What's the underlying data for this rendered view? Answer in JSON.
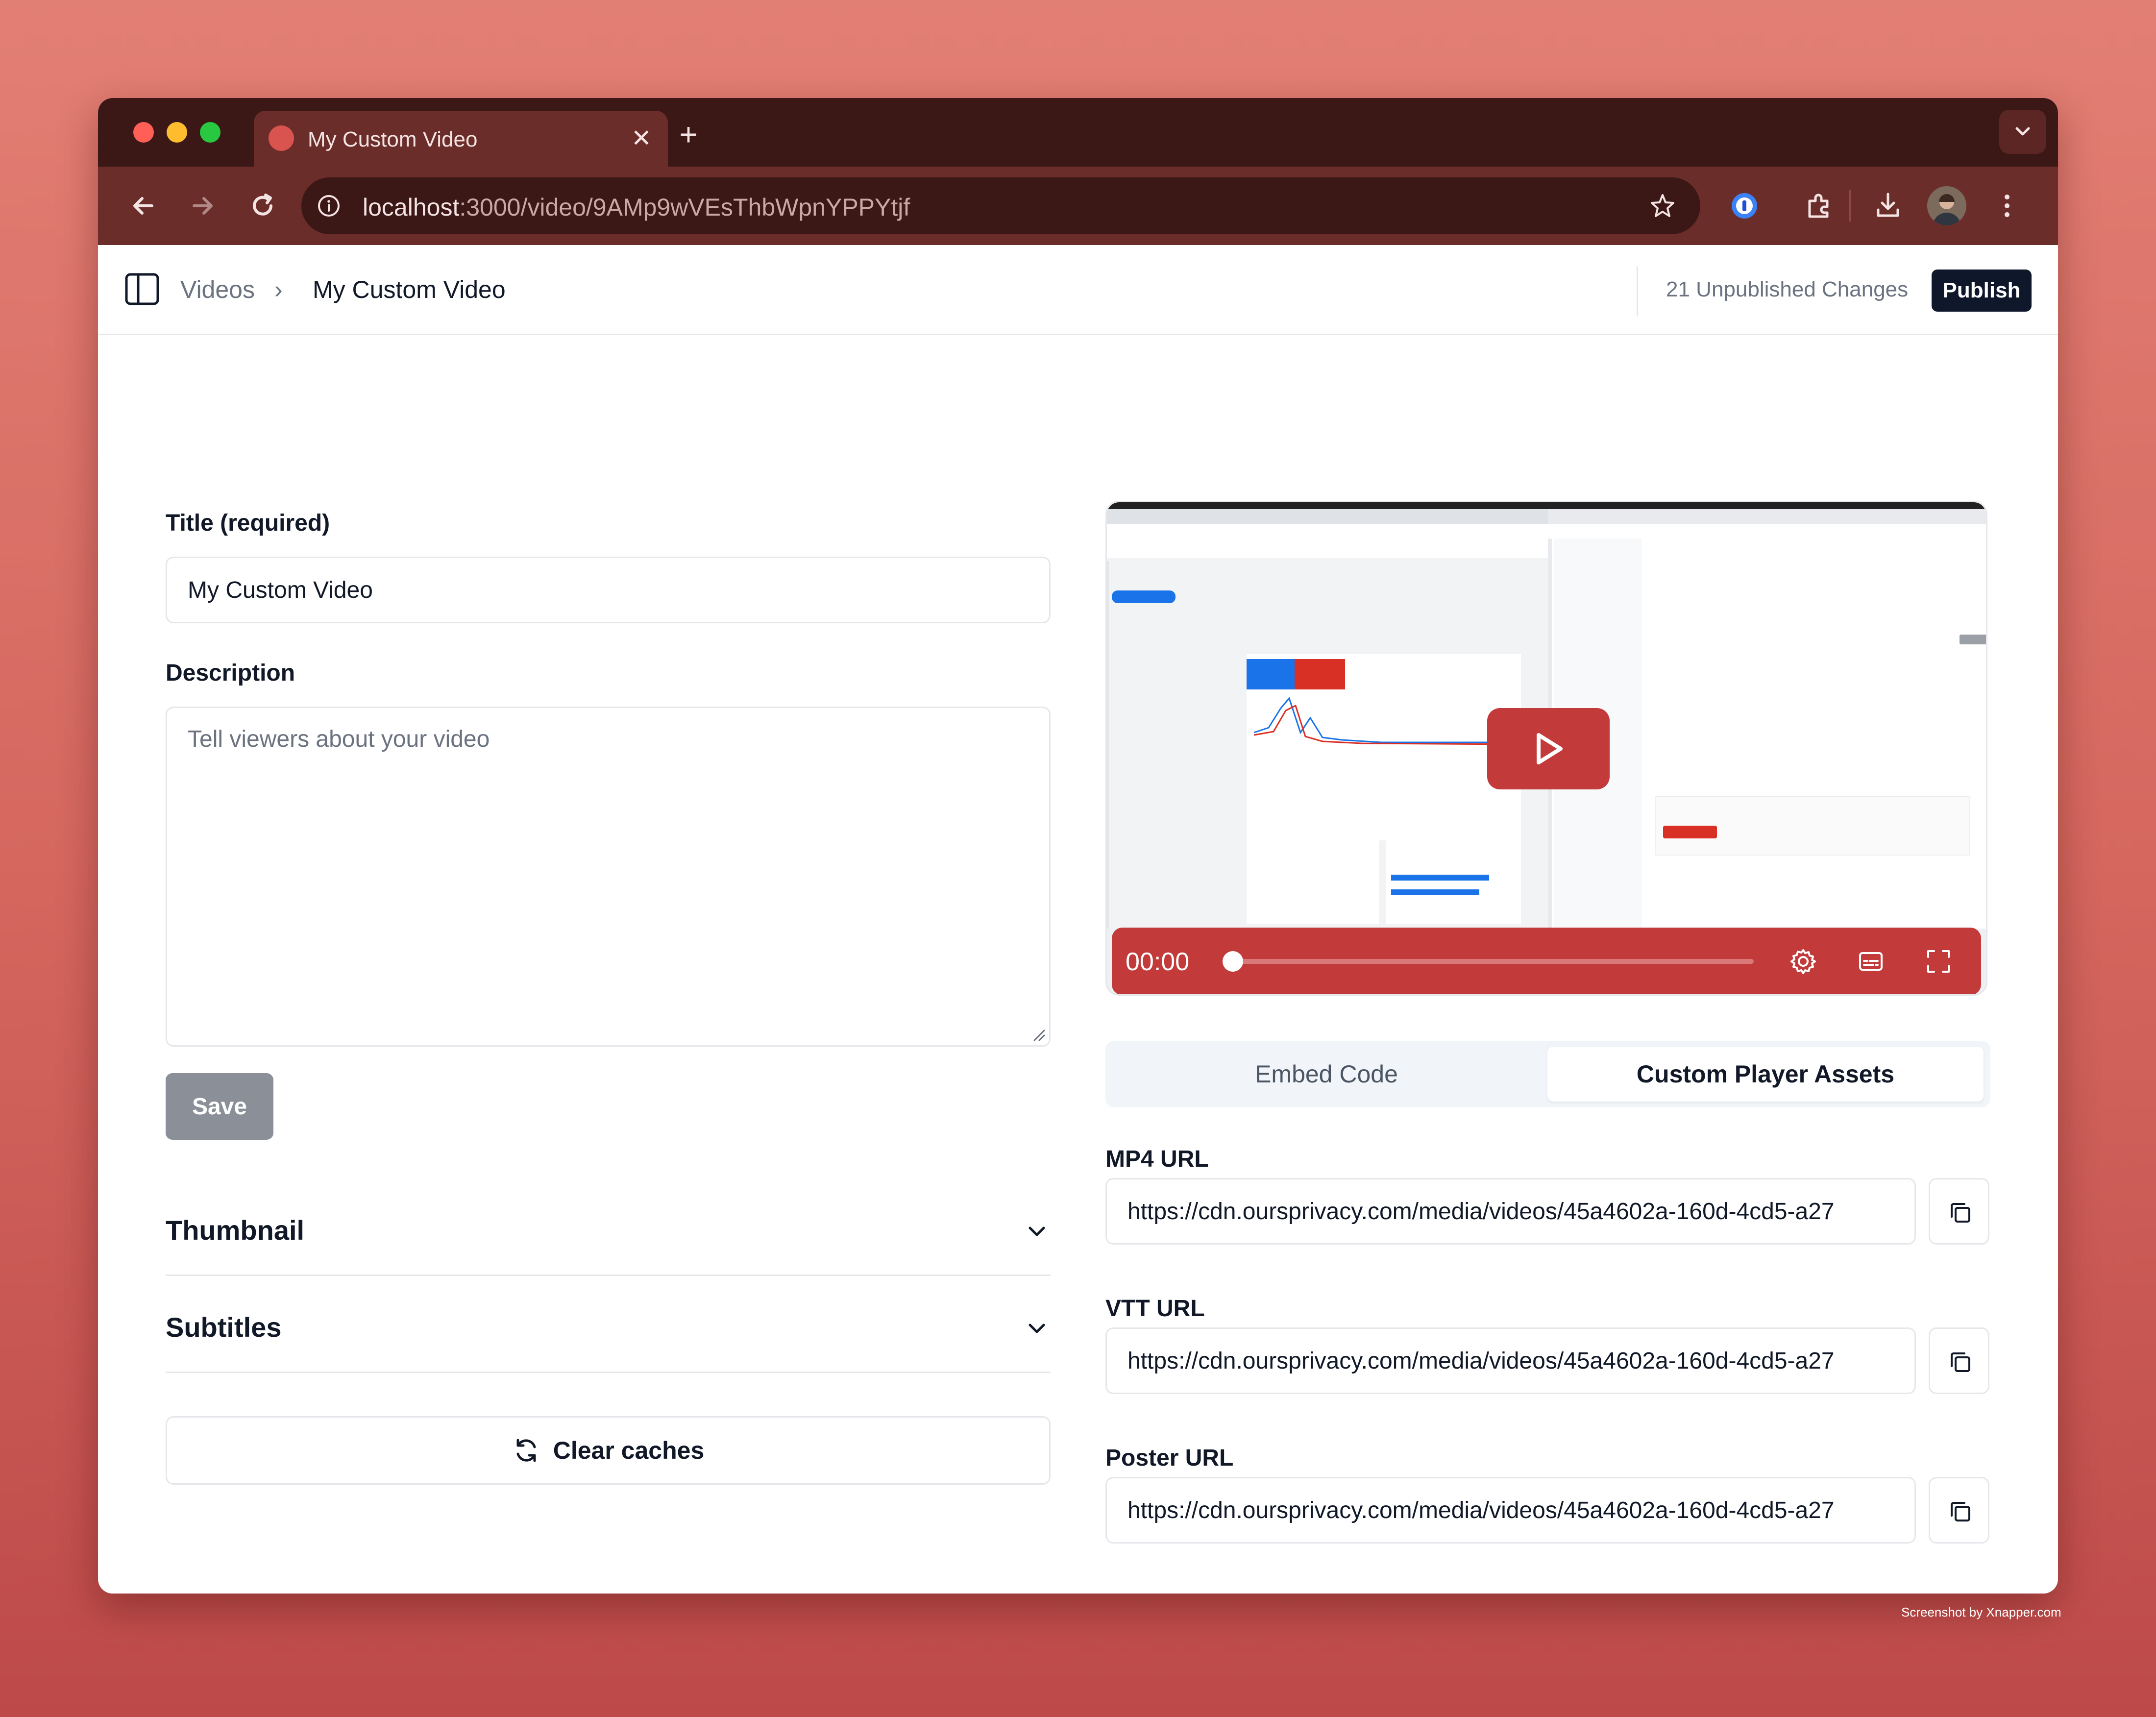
{
  "browser": {
    "tab_title": "My Custom Video",
    "new_tab_label": "+",
    "close_tab_label": "✕",
    "url_host": "localhost",
    "url_path": ":3000/video/9AMp9wVEsThbWpnYPPYtjf"
  },
  "header": {
    "breadcrumb_parent": "Videos",
    "breadcrumb_separator": "›",
    "breadcrumb_current": "My Custom Video",
    "unpublished_changes": "21 Unpublished Changes",
    "publish_label": "Publish"
  },
  "form": {
    "title_label": "Title (required)",
    "title_value": "My Custom Video",
    "description_label": "Description",
    "description_placeholder": "Tell viewers about your video",
    "save_label": "Save"
  },
  "sections": {
    "thumbnail": "Thumbnail",
    "subtitles": "Subtitles",
    "clear_caches": "Clear caches"
  },
  "player": {
    "time": "00:00",
    "progress": 0,
    "accent_color": "#c23a3a"
  },
  "tabs": {
    "embed": "Embed Code",
    "assets": "Custom Player Assets",
    "active": "Custom Player Assets"
  },
  "assets": {
    "mp4_label": "MP4 URL",
    "mp4_value": "https://cdn.oursprivacy.com/media/videos/45a4602a-160d-4cd5-a27",
    "vtt_label": "VTT URL",
    "vtt_value": "https://cdn.oursprivacy.com/media/videos/45a4602a-160d-4cd5-a27",
    "poster_label": "Poster URL",
    "poster_value": "https://cdn.oursprivacy.com/media/videos/45a4602a-160d-4cd5-a27"
  },
  "watermark": "Screenshot by Xnapper.com"
}
